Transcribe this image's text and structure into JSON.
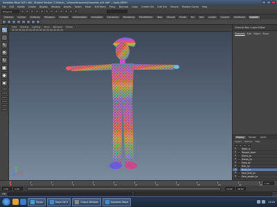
{
  "window": {
    "title": "Autodesk Maya 2011 x64 - Student Version: C:\\Users\\... \\character\\scenes\\character_v01.mb* --- body_MESH"
  },
  "menubar": {
    "items": [
      "File",
      "Edit",
      "Modify",
      "Create",
      "Display",
      "Window",
      "Assets",
      "Select",
      "Mesh",
      "Edit Mesh",
      "Proxy",
      "Normals",
      "Color",
      "Create UVs",
      "Edit UVs",
      "Muscle",
      "Pipeline Cache",
      "Help"
    ]
  },
  "status_line": {
    "mode": "Polygons"
  },
  "shelf": {
    "tabs": [
      "General",
      "Curves",
      "Surfaces",
      "Polygons",
      "Subdivs",
      "Deformation",
      "Animation",
      "Dynamics",
      "Rendering",
      "PaintEffects",
      "Toon",
      "Muscle",
      "Fluids",
      "Fur",
      "Hair",
      "nCloth",
      "Custom",
      "GoZBrush",
      "Custom"
    ],
    "active_tab": 18
  },
  "viewport": {
    "panel_menu": [
      "View",
      "Shading",
      "Lighting",
      "Show",
      "Renderer",
      "Panels"
    ]
  },
  "channel_box": {
    "title": "Channel Box / Layer Editor",
    "tabs": [
      "Channels",
      "Edit",
      "Object",
      "Show"
    ]
  },
  "layer_editor": {
    "tabs": [
      "Display",
      "Render",
      "Anim"
    ],
    "menu": [
      "Layers",
      "Options",
      "Help"
    ],
    "layers": [
      {
        "name": "Teeth_ly",
        "visible": "V",
        "selected": false
      },
      {
        "name": "Tongue_layer",
        "visible": "V",
        "selected": false
      },
      {
        "name": "Gums_lyr",
        "visible": "V",
        "selected": false
      },
      {
        "name": "Hands_lyr",
        "visible": "V",
        "selected": false
      },
      {
        "name": "Eyes_lyr",
        "visible": "V",
        "selected": false
      },
      {
        "name": "Hair_lyr",
        "visible": "V",
        "selected": false
      },
      {
        "name": "Body_lyr",
        "visible": "V",
        "selected": true
      },
      {
        "name": "Face_brdl_lyr",
        "visible": "V",
        "selected": false
      },
      {
        "name": "Face_shape_lyr",
        "visible": "V",
        "selected": false
      }
    ]
  },
  "time_slider": {
    "ticks": [
      "1",
      "2",
      "4",
      "6",
      "8",
      "10",
      "12",
      "14",
      "16",
      "18",
      "20",
      "22",
      "24"
    ],
    "current_frame": "1.00"
  },
  "range_slider": {
    "start": "1.00",
    "start_inner": "1.00",
    "end_inner": "24.00",
    "end": "48.00"
  },
  "command_line": {
    "label": "MEL"
  },
  "taskbar": {
    "buttons": [
      {
        "label": "Skype",
        "icon_color": "#3aa0e0"
      },
      {
        "label": "Maya 2011",
        "icon_color": "#3a8fd0"
      },
      {
        "label": "Output Window",
        "icon_color": "#888888"
      },
      {
        "label": "Autodesk Maya",
        "icon_color": "#3a8fd0"
      }
    ],
    "clock": "13:24"
  },
  "colors": {
    "viewport_top": "#3d4858",
    "viewport_bottom": "#7c8ba0",
    "selected_layer": "#5a7ba8"
  }
}
